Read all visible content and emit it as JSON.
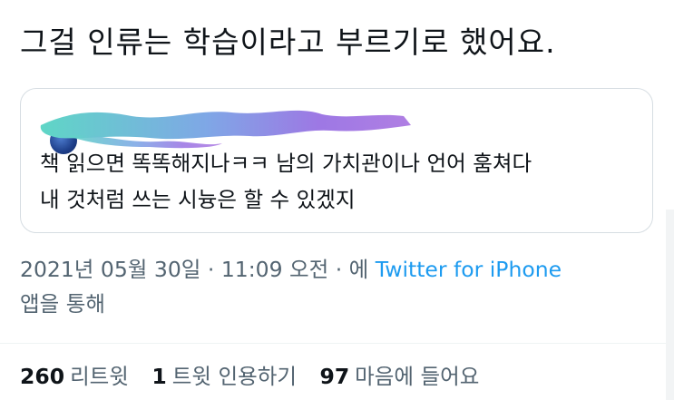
{
  "tweet": {
    "text": "그걸 인류는 학습이라고 부르기로 했어요."
  },
  "quote": {
    "body_line1": "책 읽으면 똑똑해지나ㅋㅋ 남의 가치관이나 언어 훔쳐다",
    "body_line2": "내 것처럼 쓰는 시늉은 할 수 있겠지",
    "redaction_colors": [
      "#64d2c8",
      "#8a7fe0",
      "#a86ee6"
    ]
  },
  "meta": {
    "timestamp": "2021년 05월 30일 · 11:09 오전 · 에 ",
    "source": "Twitter for iPhone",
    "suffix": "앱을 통해"
  },
  "stats": {
    "retweets": {
      "count": "260",
      "label": "리트윗"
    },
    "quotes": {
      "count": "1",
      "label": "트윗 인용하기"
    },
    "likes": {
      "count": "97",
      "label": "마음에 들어요"
    }
  },
  "colors": {
    "text": "#0f1419",
    "secondary": "#536471",
    "link": "#1d9bf0",
    "border": "#d6dde2"
  }
}
